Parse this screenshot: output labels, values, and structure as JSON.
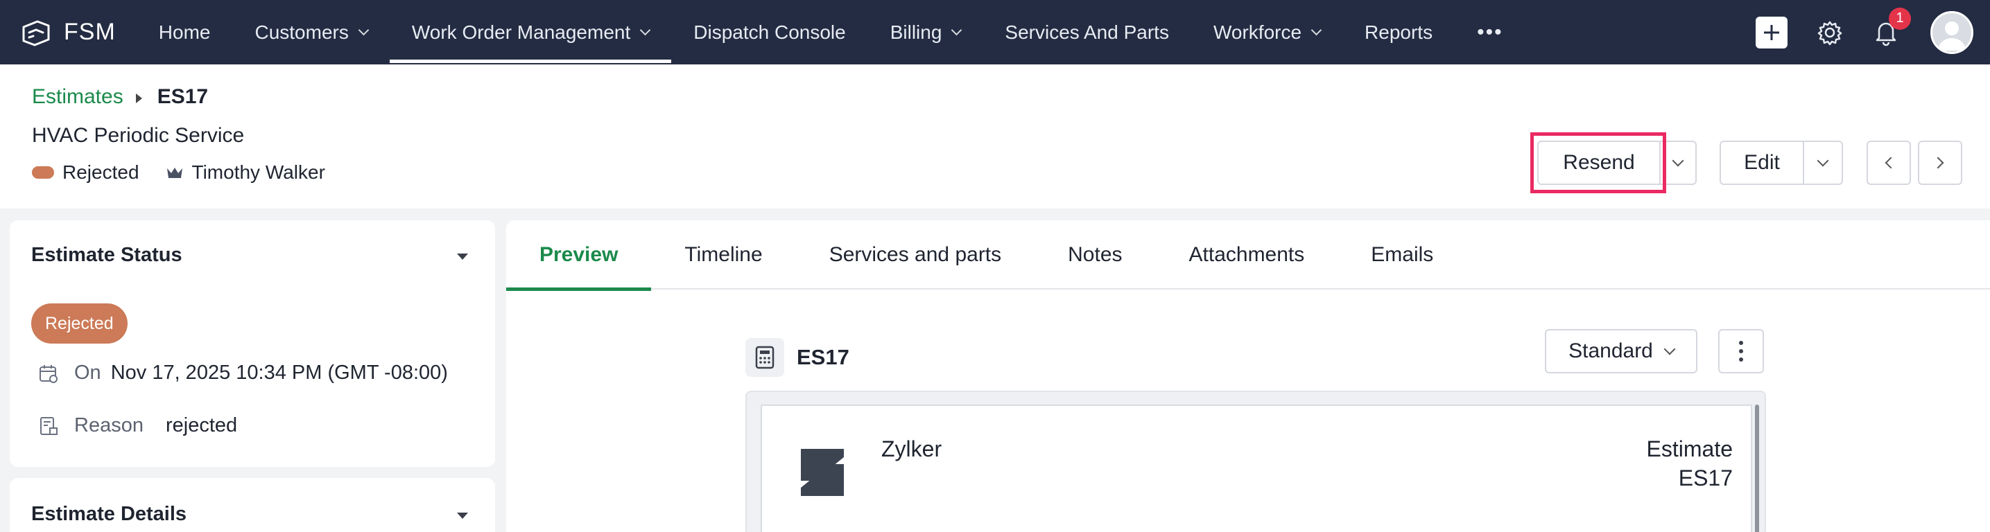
{
  "app": {
    "name": "FSM"
  },
  "nav": {
    "items": [
      {
        "label": "Home",
        "dropdown": false,
        "active": false
      },
      {
        "label": "Customers",
        "dropdown": true,
        "active": false
      },
      {
        "label": "Work Order Management",
        "dropdown": true,
        "active": true
      },
      {
        "label": "Dispatch Console",
        "dropdown": false,
        "active": false
      },
      {
        "label": "Billing",
        "dropdown": true,
        "active": false
      },
      {
        "label": "Services And Parts",
        "dropdown": false,
        "active": false
      },
      {
        "label": "Workforce",
        "dropdown": true,
        "active": false
      },
      {
        "label": "Reports",
        "dropdown": false,
        "active": false
      }
    ],
    "more": "•••",
    "notification_count": "1"
  },
  "header": {
    "breadcrumb": {
      "parent": "Estimates",
      "current": "ES17"
    },
    "subtitle": "HVAC Periodic Service",
    "status": "Rejected",
    "owner": "Timothy Walker",
    "resend_label": "Resend",
    "edit_label": "Edit"
  },
  "status_card": {
    "title": "Estimate Status",
    "badge": "Rejected",
    "on_label": "On",
    "on_value": "Nov 17, 2025 10:34 PM (GMT -08:00)",
    "reason_label": "Reason",
    "reason_value": "rejected"
  },
  "details_card": {
    "title": "Estimate Details"
  },
  "tabs": [
    "Preview",
    "Timeline",
    "Services and parts",
    "Notes",
    "Attachments",
    "Emails"
  ],
  "active_tab": "Preview",
  "preview": {
    "doc_id": "ES17",
    "template": "Standard",
    "company": "Zylker",
    "doc_type": "Estimate",
    "doc_number": "ES17"
  },
  "colors": {
    "nav_bg": "#232c42",
    "accent_green": "#1b8a4b",
    "rejected": "#cc7a57",
    "highlight": "#ea2a62",
    "badge_red": "#e4344a"
  },
  "icons": [
    "fsm-logo-icon",
    "chevron-down-icon",
    "plus-icon",
    "gear-icon",
    "bell-icon",
    "crown-icon",
    "calendar-icon",
    "reason-icon",
    "calculator-icon",
    "kebab-icon",
    "zylker-logo-icon"
  ]
}
